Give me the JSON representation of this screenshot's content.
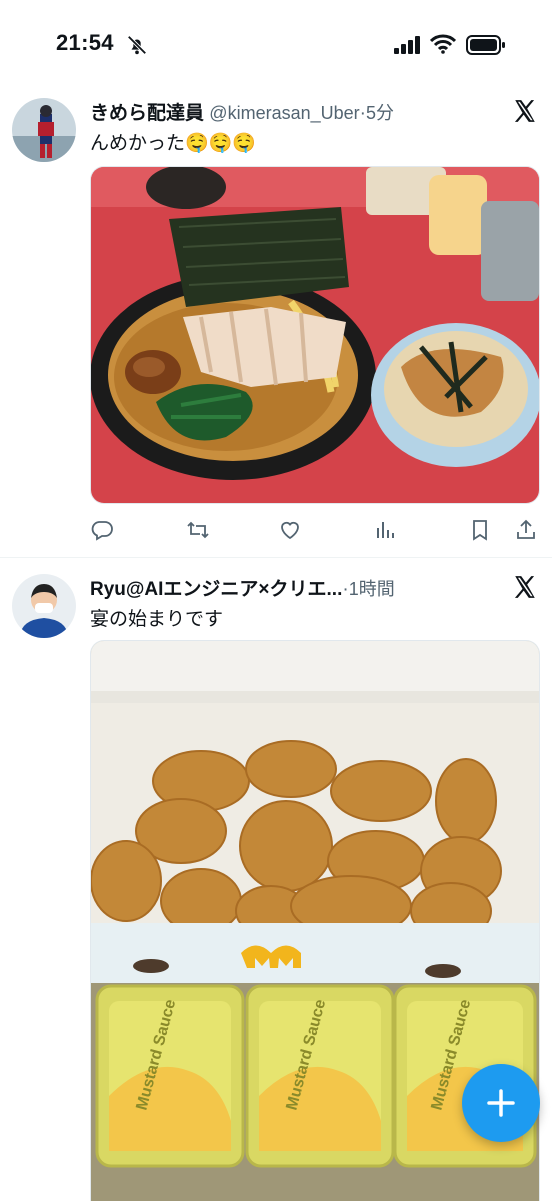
{
  "status_bar": {
    "time": "21:54"
  },
  "tweets": [
    {
      "display_name": "きめら配達員",
      "handle": "@kimerasan_Uber",
      "separator": "·",
      "time": "5分",
      "text": "んめかった🤤🤤🤤"
    },
    {
      "display_name": "Ryu@AIエンジニア×クリエ...",
      "separator": "·",
      "time": "1時間",
      "text": "宴の始まりです",
      "sauce_labels": [
        "Mustard Sauce",
        "Mustard Sauce",
        "Mustard Sauce"
      ]
    }
  ],
  "colors": {
    "accent": "#1d9bf0",
    "muted": "#536471",
    "text": "#0f1419"
  },
  "icons": [
    "bell-off-icon",
    "signal-icon",
    "wifi-icon",
    "battery-icon",
    "x-logo-icon",
    "reply-icon",
    "retweet-icon",
    "like-icon",
    "views-icon",
    "bookmark-icon",
    "share-icon",
    "plus-icon"
  ]
}
